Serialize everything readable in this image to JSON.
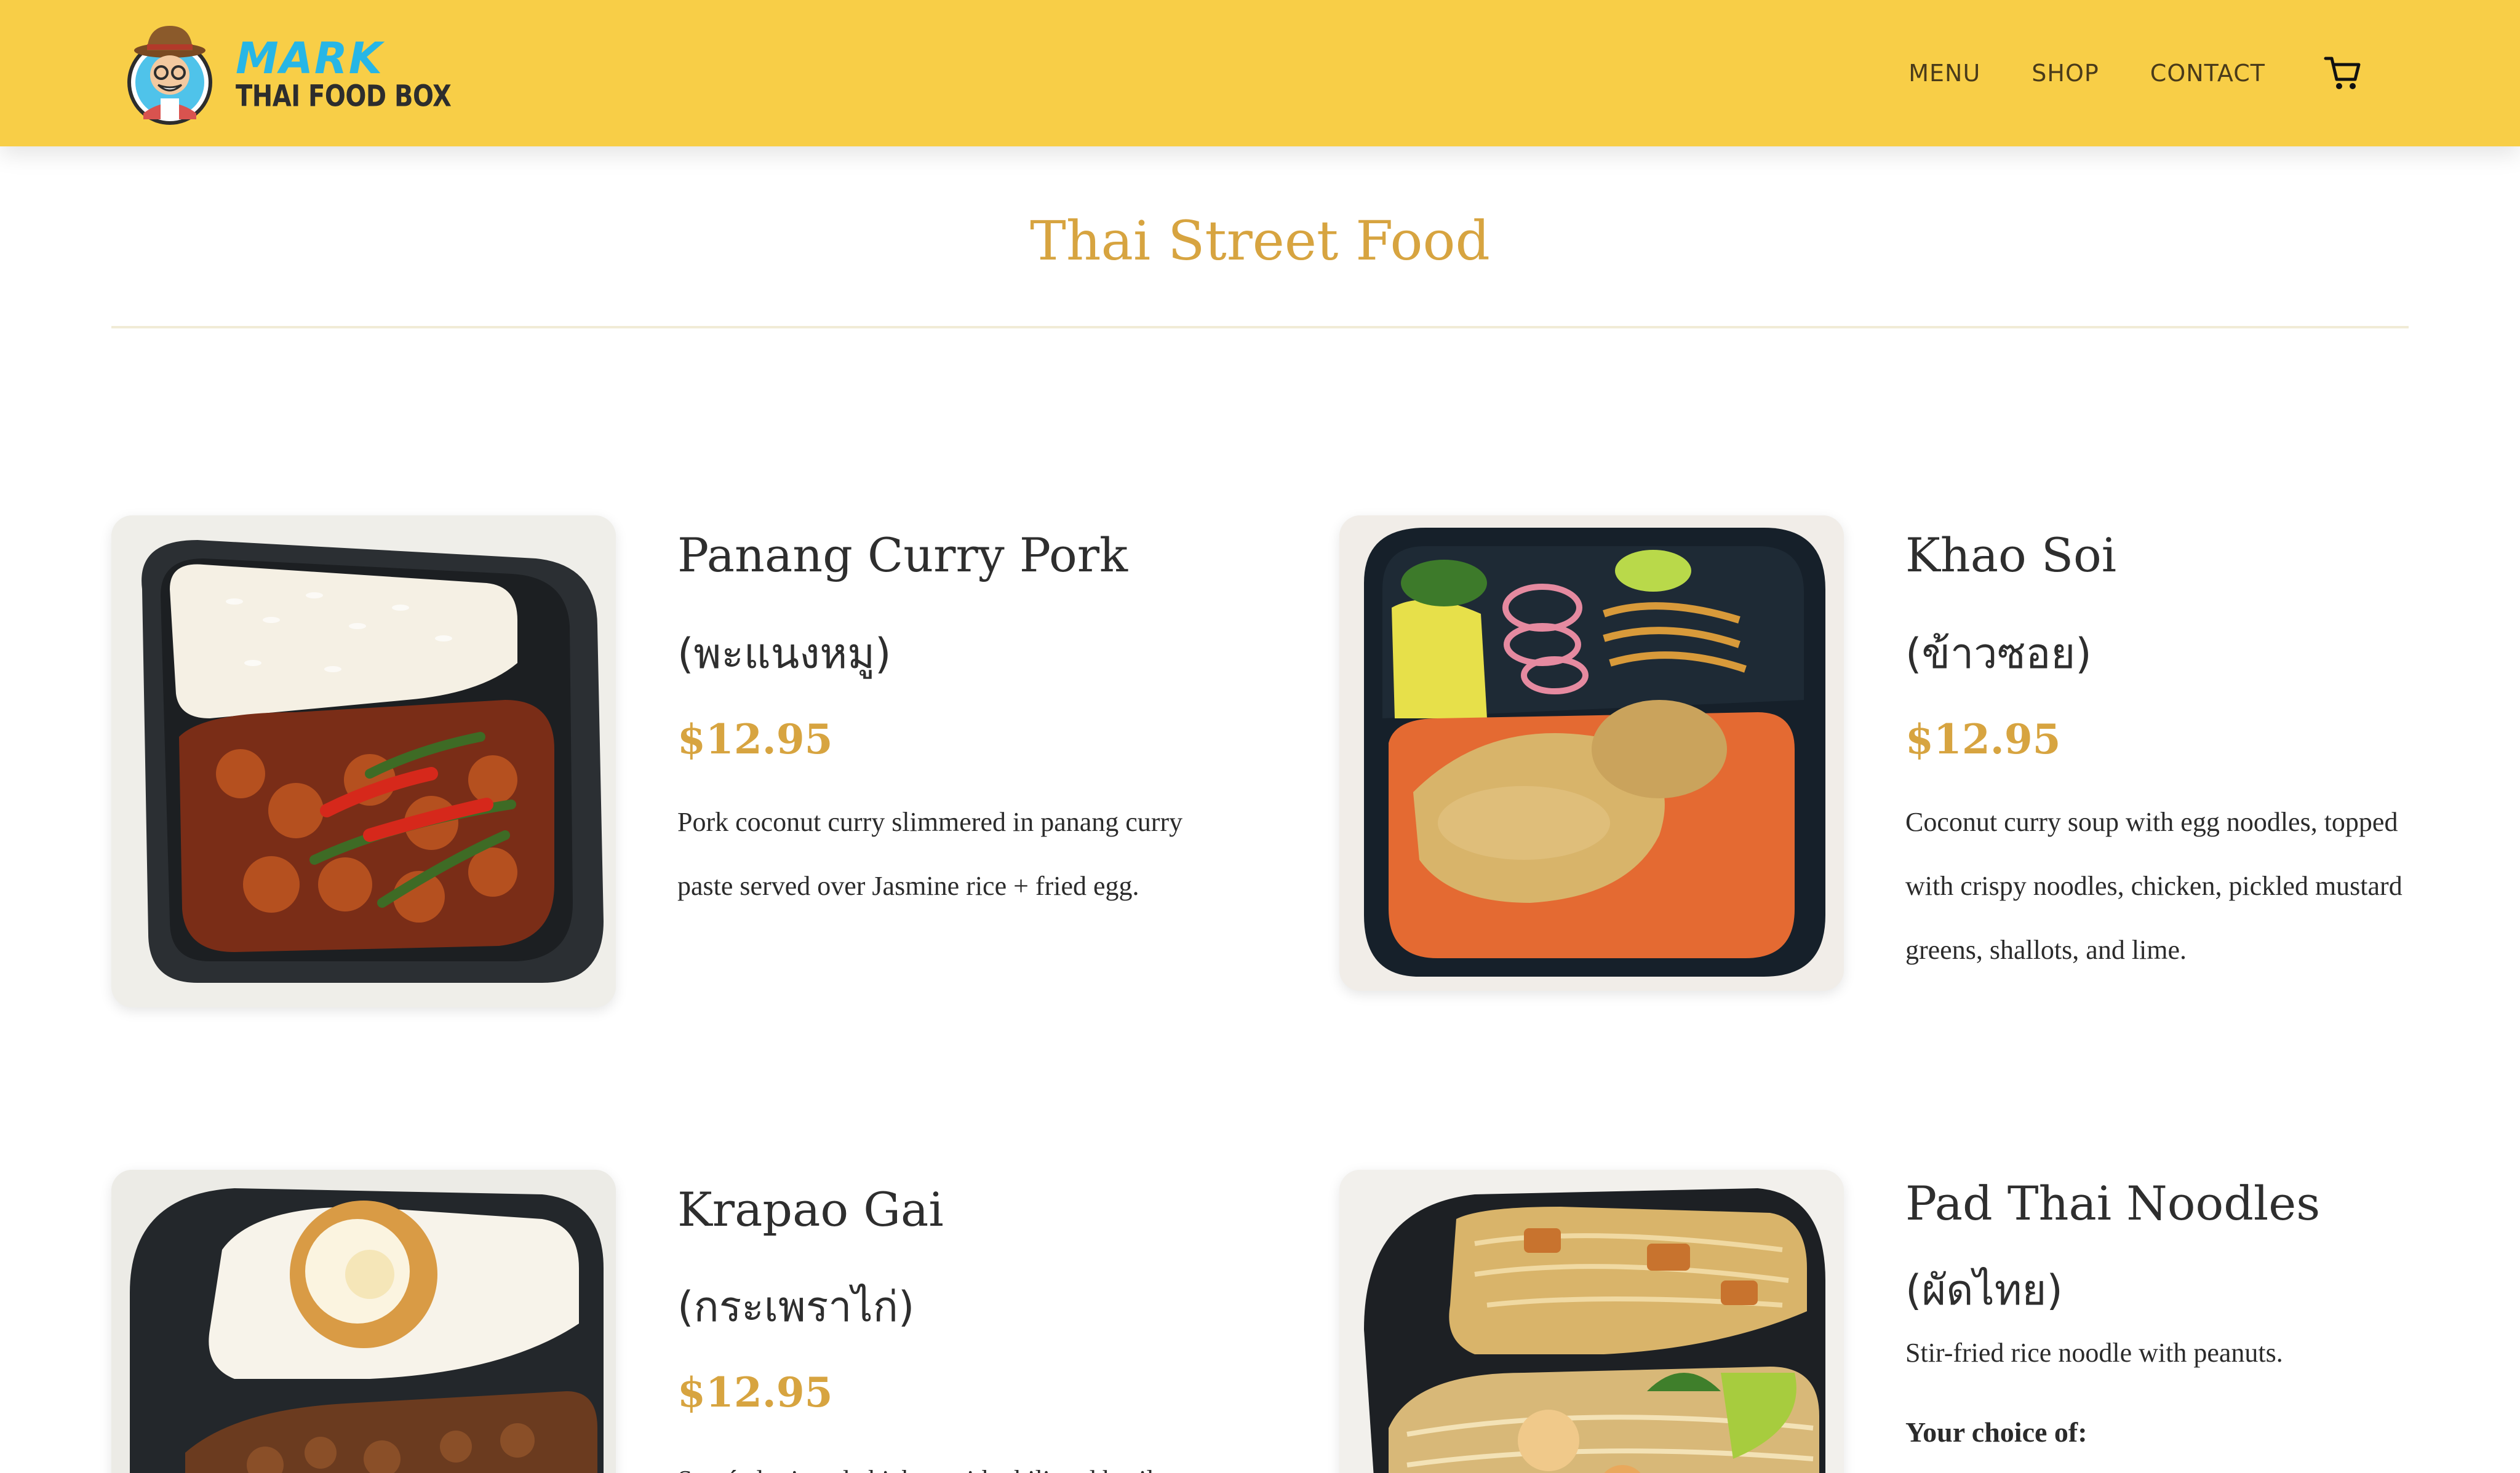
{
  "brand": {
    "mark": "MARK",
    "sub": "THAI FOOD BOX",
    "logo_icon": "chef-mascot-icon"
  },
  "nav": {
    "menu": "MENU",
    "shop": "SHOP",
    "contact": "CONTACT",
    "cart_icon": "cart-icon"
  },
  "section": {
    "title": "Thai Street Food"
  },
  "items": [
    {
      "name": "Panang Curry Pork",
      "thai": "(พะแนงหมู)",
      "price": "$12.95",
      "desc": "Pork coconut curry slimmered in panang curry paste served over Jasmine rice + fried egg."
    },
    {
      "name": "Khao Soi",
      "thai": "(ข้าวซอย)",
      "price": "$12.95",
      "desc": "Coconut curry soup with egg noodles, topped with crispy noodles, chicken, pickled mustard greens, shallots, and lime."
    },
    {
      "name": "Krapao Gai",
      "thai": "(กระเพราไก่)",
      "price": "$12.95",
      "desc": "Sautéed minced chicken with chili and basil"
    },
    {
      "name": "Pad Thai Noodles",
      "thai": "(ผัดไทย)",
      "desc": "Stir-fried rice noodle with peanuts.",
      "choice_label": "Your choice of:"
    }
  ],
  "colors": {
    "header_bg": "#f8ce47",
    "accent_gold": "#d7a440",
    "logo_blue": "#27b6e6"
  }
}
